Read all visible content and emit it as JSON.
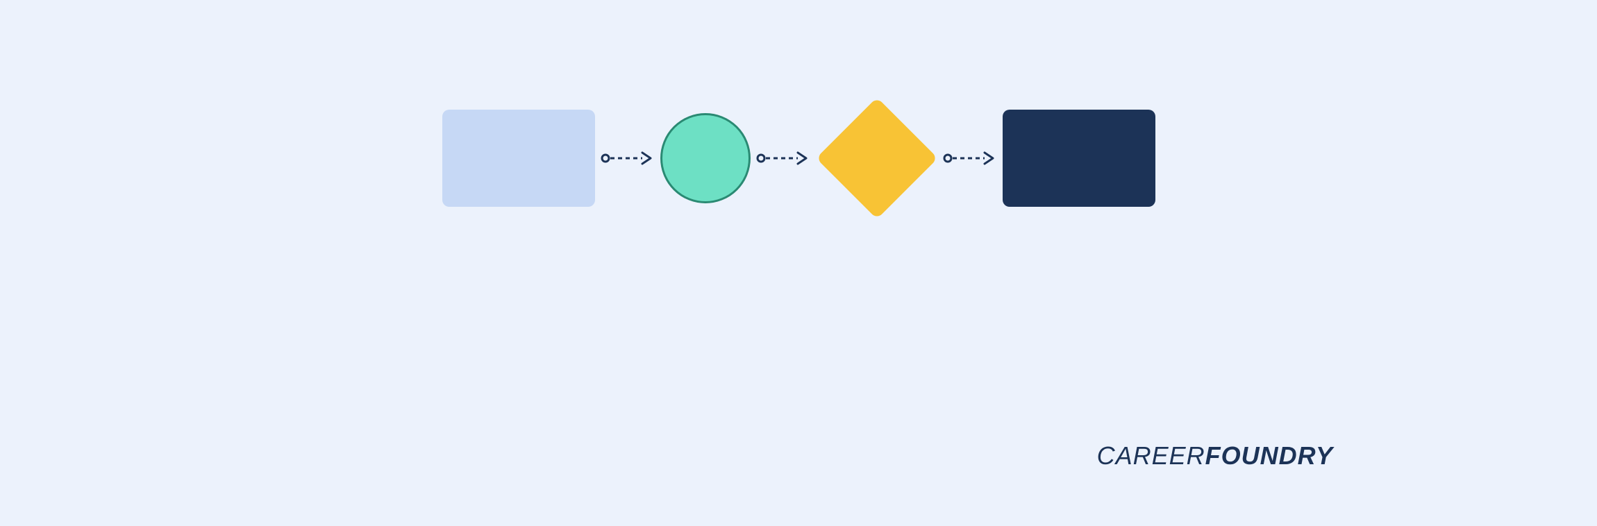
{
  "brand": {
    "part1": "CAREER",
    "part2": "FOUNDRY"
  },
  "shapes": [
    {
      "type": "rectangle-light",
      "color": "#c6d8f5"
    },
    {
      "type": "circle",
      "color": "#6de0c4",
      "border": "#2a8a73"
    },
    {
      "type": "diamond",
      "color": "#f8c335"
    },
    {
      "type": "rectangle-dark",
      "color": "#1c3357"
    }
  ],
  "connectors": {
    "count": 3,
    "style": "dashed-arrow",
    "color": "#1c3357"
  },
  "background": "#ecf2fc"
}
